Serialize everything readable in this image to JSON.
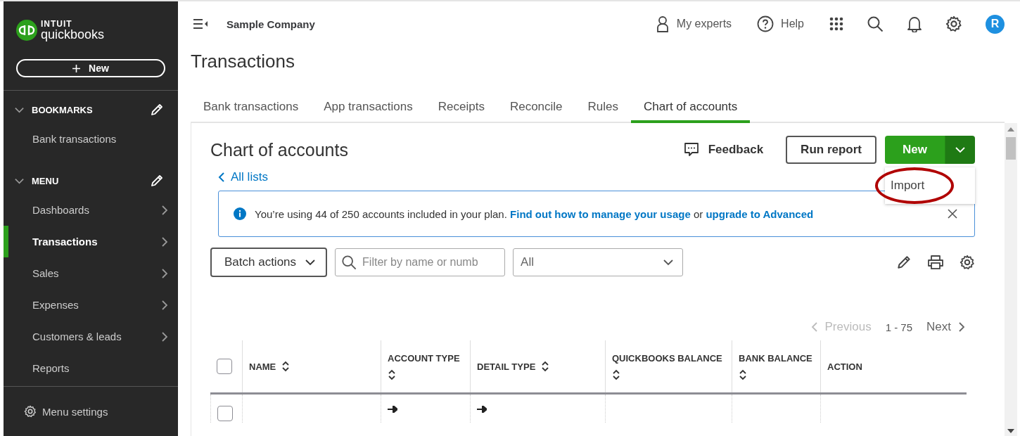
{
  "sidebar": {
    "brand": {
      "maker": "INTUIT",
      "product": "quickbooks"
    },
    "new_button": "New",
    "sections": [
      {
        "title": "BOOKMARKS",
        "expanded": true,
        "items": [
          {
            "label": "Bank transactions",
            "selected": false,
            "submenu": false
          }
        ]
      },
      {
        "title": "MENU",
        "expanded": true,
        "items": [
          {
            "label": "Dashboards",
            "selected": false,
            "submenu": true
          },
          {
            "label": "Transactions",
            "selected": true,
            "submenu": true
          },
          {
            "label": "Sales",
            "selected": false,
            "submenu": true
          },
          {
            "label": "Expenses",
            "selected": false,
            "submenu": true
          },
          {
            "label": "Customers & leads",
            "selected": false,
            "submenu": true
          },
          {
            "label": "Reports",
            "selected": false,
            "submenu": false
          }
        ]
      }
    ],
    "footer": "Menu settings"
  },
  "topbar": {
    "company": "Sample Company",
    "my_experts": "My experts",
    "help": "Help",
    "avatar": "R"
  },
  "page_title": "Transactions",
  "tabs": [
    {
      "label": "Bank transactions",
      "selected": false
    },
    {
      "label": "App transactions",
      "selected": false
    },
    {
      "label": "Receipts",
      "selected": false
    },
    {
      "label": "Reconcile",
      "selected": false
    },
    {
      "label": "Rules",
      "selected": false
    },
    {
      "label": "Chart of accounts",
      "selected": true
    }
  ],
  "content": {
    "heading": "Chart of accounts",
    "feedback": "Feedback",
    "run_report": "Run report",
    "new_button": {
      "label": "New",
      "expanded": true,
      "menu": [
        {
          "label": "Import",
          "circled": true
        }
      ]
    },
    "back_link": "All lists",
    "banner": {
      "parts": [
        {
          "kind": "text",
          "text": "You’re using 44 of 250 accounts included in your plan. "
        },
        {
          "kind": "link",
          "text": "Find out how to manage your usage"
        },
        {
          "kind": "text",
          "text": " or "
        },
        {
          "kind": "link",
          "text": "upgrade to Advanced"
        }
      ]
    },
    "batch_actions": "Batch actions",
    "filter": {
      "placeholder": "Filter by name or numb"
    },
    "type_select": "All",
    "pagination": {
      "previous": "Previous",
      "previous_disabled": true,
      "range": "1 - 75",
      "next": "Next",
      "next_disabled": false
    },
    "table": {
      "columns": [
        {
          "label": "NAME",
          "sortable": true
        },
        {
          "label": "ACCOUNT TYPE",
          "sortable": true
        },
        {
          "label": "DETAIL TYPE",
          "sortable": true
        },
        {
          "label": "QUICKBOOKS BALANCE",
          "sortable": true
        },
        {
          "label": "BANK BALANCE",
          "sortable": true
        },
        {
          "label": "ACTION",
          "sortable": false
        }
      ],
      "header_checked": false,
      "rows": [
        {
          "checked": false
        }
      ]
    }
  }
}
